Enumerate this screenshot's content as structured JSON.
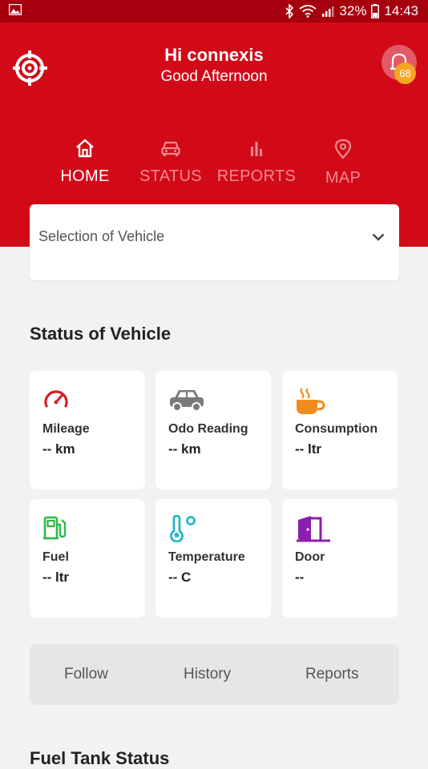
{
  "status_bar": {
    "battery": "32%",
    "time": "14:43"
  },
  "header": {
    "greeting_name": "Hi connexis",
    "greeting_sub": "Good Afternoon",
    "notification_count": "68"
  },
  "nav": {
    "items": [
      {
        "label": "HOME",
        "icon": "home-icon",
        "active": true
      },
      {
        "label": "STATUS",
        "icon": "car-icon",
        "active": false
      },
      {
        "label": "REPORTS",
        "icon": "bar-chart-icon",
        "active": false
      },
      {
        "label": "MAP",
        "icon": "location-pin-icon",
        "active": false
      }
    ]
  },
  "vehicle_select": {
    "placeholder": "Selection of Vehicle"
  },
  "status_section": {
    "title": "Status of Vehicle",
    "cards": [
      {
        "title": "Mileage",
        "value": "-- km",
        "icon": "speedometer-icon",
        "color": "#d6202b"
      },
      {
        "title": "Odo Reading",
        "value": "-- km",
        "icon": "car-icon",
        "color": "#7a7a7a"
      },
      {
        "title": "Consumption",
        "value": "-- ltr",
        "icon": "coffee-cup-icon",
        "color": "#f08c1e"
      },
      {
        "title": "Fuel",
        "value": "-- ltr",
        "icon": "fuel-pump-icon",
        "color": "#2fb84a"
      },
      {
        "title": "Temperature",
        "value": "-- C",
        "icon": "thermometer-icon",
        "color": "#23b7c9"
      },
      {
        "title": "Door",
        "value": "--",
        "icon": "door-icon",
        "color": "#8a1fb0"
      }
    ]
  },
  "actions": {
    "follow": "Follow",
    "history": "History",
    "reports": "Reports"
  },
  "fuel_section": {
    "title": "Fuel Tank Status"
  },
  "colors": {
    "primary": "#d20a18",
    "status_bar": "#a6000f",
    "badge": "#f5a623"
  }
}
